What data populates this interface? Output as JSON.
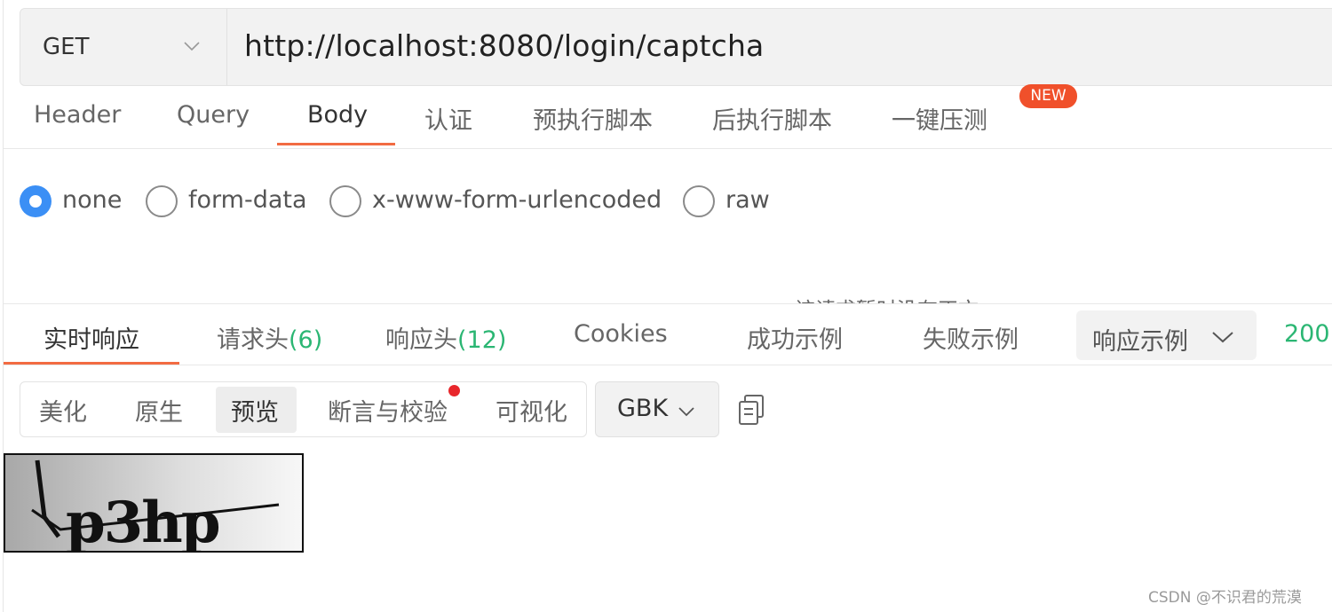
{
  "request": {
    "method": "GET",
    "url": "http://localhost:8080/login/captcha"
  },
  "request_tabs": [
    "Header",
    "Query",
    "Body",
    "认证",
    "预执行脚本",
    "后执行脚本",
    "一键压测"
  ],
  "request_tabs_active": "Body",
  "new_badge": "NEW",
  "body_types": {
    "options": [
      "none",
      "form-data",
      "x-www-form-urlencoded",
      "raw"
    ],
    "selected": "none"
  },
  "body_empty_message": "该请求暂时没有正文",
  "response_tabs": {
    "live": "实时响应",
    "req_headers_label": "请求头",
    "req_headers_count": "(6)",
    "resp_headers_label": "响应头",
    "resp_headers_count": "(12)",
    "cookies": "Cookies",
    "success_example": "成功示例",
    "fail_example": "失败示例"
  },
  "example_select": "响应示例",
  "status_code": "200",
  "view_modes": {
    "options": [
      "美化",
      "原生",
      "预览",
      "断言与校验",
      "可视化"
    ],
    "selected": "预览"
  },
  "encoding": "GBK",
  "captcha_text": "Lp3hp",
  "watermark": "CSDN @不识君的荒漠",
  "colors": {
    "accent": "#f26b42",
    "radio_checked": "#3b8ff5",
    "count_green": "#2bb673",
    "badge_red": "#f0502b"
  },
  "icons": [
    "chevron-down-icon",
    "copy-icon"
  ]
}
